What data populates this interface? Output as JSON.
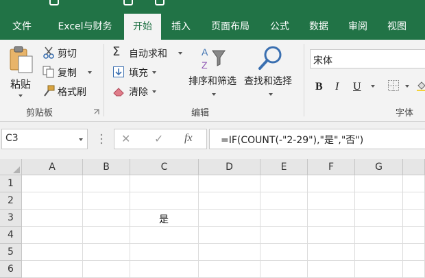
{
  "tabs": [
    "文件",
    "Excel与财务",
    "开始",
    "插入",
    "页面布局",
    "公式",
    "数据",
    "审阅",
    "视图"
  ],
  "active_tab": "开始",
  "clipboard": {
    "paste": "粘贴",
    "cut": "剪切",
    "copy": "复制",
    "format_painter": "格式刷",
    "group_label": "剪贴板"
  },
  "editing": {
    "autosum": "自动求和",
    "fill": "填充",
    "clear": "清除",
    "sort_filter": "排序和筛选",
    "find_select": "查找和选择",
    "group_label": "编辑"
  },
  "font": {
    "name": "宋体",
    "bold": "B",
    "italic": "I",
    "underline": "U",
    "group_label": "字体"
  },
  "formula_bar": {
    "name_box": "C3",
    "cancel": "✕",
    "enter": "✓",
    "fx": "fx",
    "formula": "=IF(COUNT(-\"2-29\"),\"是\",\"否\")"
  },
  "sheet": {
    "columns": [
      "A",
      "B",
      "C",
      "D",
      "E",
      "F",
      "G"
    ],
    "rows": [
      "1",
      "2",
      "3",
      "4",
      "5",
      "6"
    ],
    "c3": "是"
  },
  "colors": {
    "brand": "#217346"
  }
}
